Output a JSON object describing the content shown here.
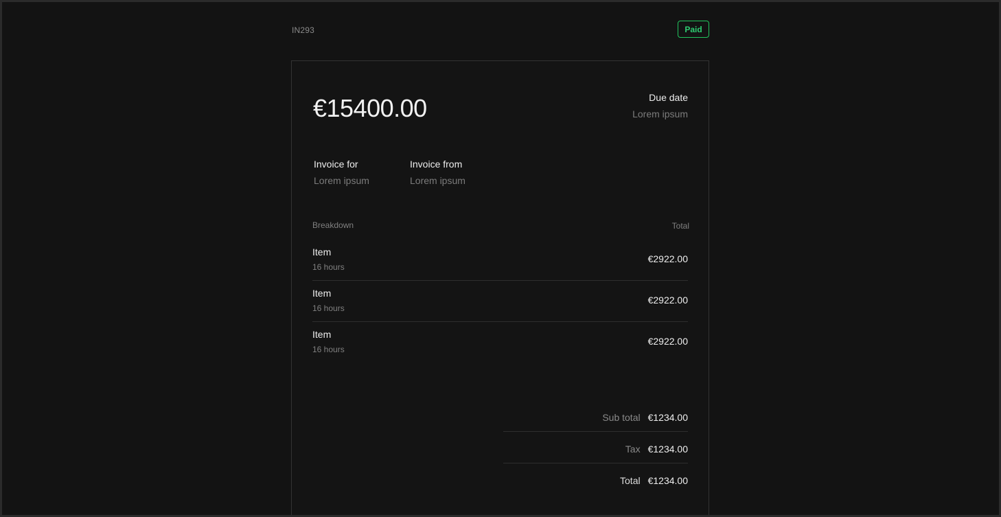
{
  "header": {
    "invoice_id": "IN293",
    "status": "Paid"
  },
  "invoice": {
    "amount": "€15400.00",
    "due_date": {
      "label": "Due date",
      "value": "Lorem ipsum"
    },
    "invoice_for": {
      "label": "Invoice for",
      "value": "Lorem ipsum"
    },
    "invoice_from": {
      "label": "Invoice from",
      "value": "Lorem ipsum"
    },
    "breakdown": {
      "label": "Breakdown",
      "total_label": "Total",
      "items": [
        {
          "name": "Item",
          "qty": "16 hours",
          "total": "€2922.00"
        },
        {
          "name": "Item",
          "qty": "16 hours",
          "total": "€2922.00"
        },
        {
          "name": "Item",
          "qty": "16 hours",
          "total": "€2922.00"
        }
      ]
    },
    "summary": {
      "subtotal_label": "Sub total",
      "subtotal_value": "€1234.00",
      "tax_label": "Tax",
      "tax_value": "€1234.00",
      "total_label": "Total",
      "total_value": "€1234.00"
    }
  },
  "colors": {
    "background": "#131313",
    "status_accent": "#22c55e",
    "text_primary": "#eeeeee",
    "text_muted": "#7c7c7c"
  }
}
